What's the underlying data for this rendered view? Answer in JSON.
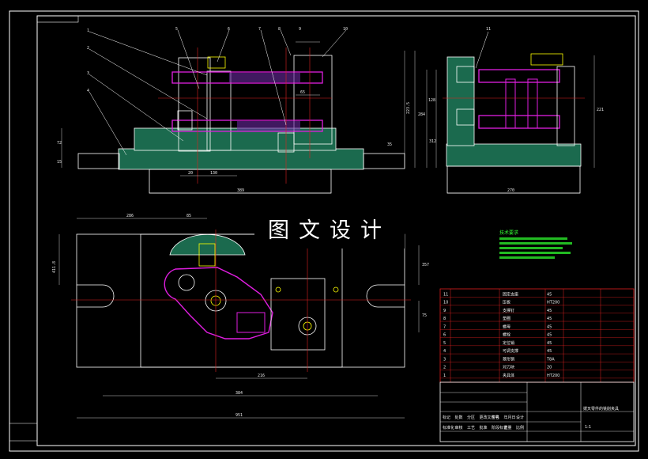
{
  "watermark": "图文设计",
  "notes_title": "技术要求",
  "dimensions": {
    "front_width": "389",
    "side_width": "270",
    "plan_width": "951",
    "plan_inner": "384",
    "plan_slot": "216",
    "plan_height": "411.8",
    "plan_top_left": "286",
    "plan_top_mid": "85",
    "plan_right": "357",
    "plan_right_low": "75",
    "front_height": "223.5",
    "front_h2": "284",
    "front_h3": "72",
    "front_h4": "15",
    "front_h5": "35",
    "side_h1": "128",
    "side_h2": "312",
    "side_h3": "221",
    "front_d1": "130",
    "front_d2": "20",
    "front_d3": "65"
  },
  "balloons": [
    "1",
    "2",
    "3",
    "4",
    "5",
    "6",
    "7",
    "8",
    "9",
    "10",
    "11"
  ],
  "bom_rows": [
    {
      "name": "固定支座",
      "mat": "45"
    },
    {
      "name": "压板",
      "mat": "HT200"
    },
    {
      "name": "支撑钉",
      "mat": "45"
    },
    {
      "name": "垫圈",
      "mat": "45"
    },
    {
      "name": "螺母",
      "mat": "45"
    },
    {
      "name": "螺栓",
      "mat": "45"
    },
    {
      "name": "定位销",
      "mat": "45"
    },
    {
      "name": "可调支撑",
      "mat": "45"
    },
    {
      "name": "菱形销",
      "mat": "T8A"
    },
    {
      "name": "对刀块",
      "mat": "20"
    },
    {
      "name": "夹具体",
      "mat": "HT200"
    }
  ],
  "title_text": "拨叉零件的铣削夹具",
  "title_scale": "1:1",
  "title_misc": [
    "标记",
    "处数",
    "分区",
    "更改文件号",
    "签名",
    "年月日",
    "设计",
    "标准化",
    "审核",
    "工艺",
    "批准",
    "阶段标记",
    "重量",
    "比例"
  ]
}
